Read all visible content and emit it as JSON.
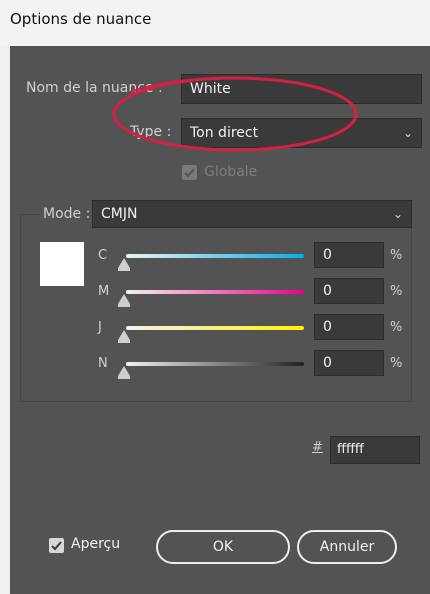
{
  "window": {
    "title": "Options de nuance"
  },
  "swatch_name": {
    "label": "Nom de la nuance :",
    "value": "White"
  },
  "type": {
    "label": "Type :",
    "selected": "Ton direct"
  },
  "global": {
    "label": "Globale",
    "checked": true,
    "disabled": true
  },
  "mode": {
    "label": "Mode :",
    "selected": "CMJN"
  },
  "channels": [
    {
      "letter": "C",
      "value": "0",
      "unit": "%",
      "level": 0,
      "color": "#00aeef"
    },
    {
      "letter": "M",
      "value": "0",
      "unit": "%",
      "level": 0,
      "color": "#ec008c"
    },
    {
      "letter": "J",
      "value": "0",
      "unit": "%",
      "level": 0,
      "color": "#fff200"
    },
    {
      "letter": "N",
      "value": "0",
      "unit": "%",
      "level": 0,
      "color": "#231f20"
    }
  ],
  "swatch_color": "#ffffff",
  "hex": {
    "label": "#",
    "value": "ffffff"
  },
  "preview": {
    "label": "Aperçu",
    "checked": true
  },
  "buttons": {
    "ok": "OK",
    "cancel": "Annuler"
  },
  "annotation": {
    "color": "#d42045"
  }
}
